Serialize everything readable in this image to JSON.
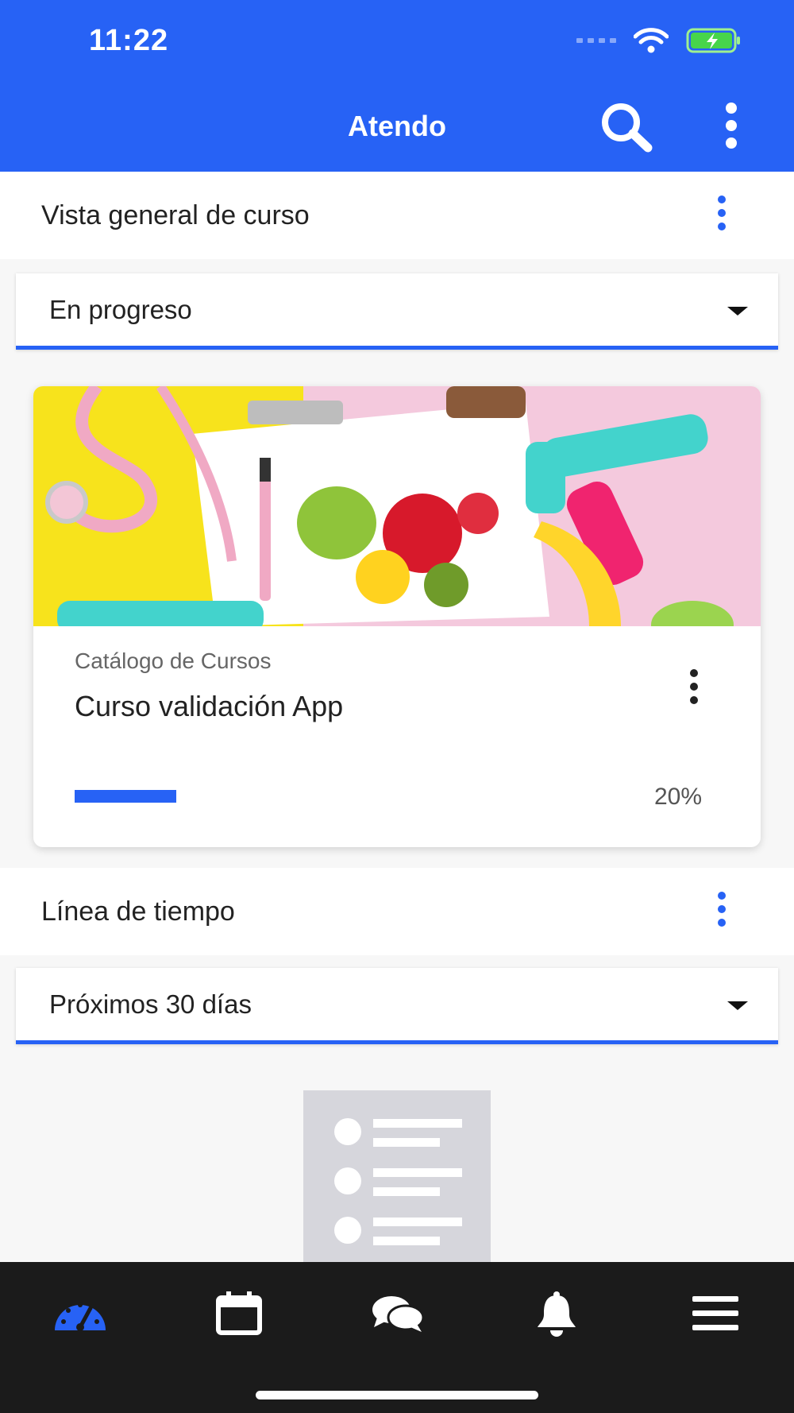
{
  "status_bar": {
    "time": "11:22"
  },
  "app_bar": {
    "title": "Atendo",
    "search_icon": "search-icon",
    "menu_icon": "kebab-menu-icon"
  },
  "course_overview": {
    "title": "Vista general de curso",
    "filter": {
      "selected": "En progreso"
    },
    "course": {
      "category": "Catálogo de Cursos",
      "name": "Curso validación App",
      "progress_value": 0.2,
      "progress_text": "20%"
    }
  },
  "timeline": {
    "title": "Línea de tiempo",
    "filter": {
      "selected": "Próximos 30 días"
    }
  },
  "bottom_nav": {
    "items": [
      {
        "icon": "dashboard-gauge-icon",
        "active": true
      },
      {
        "icon": "calendar-icon",
        "active": false
      },
      {
        "icon": "messages-icon",
        "active": false
      },
      {
        "icon": "notifications-bell-icon",
        "active": false
      },
      {
        "icon": "hamburger-menu-icon",
        "active": false
      }
    ]
  },
  "colors": {
    "primary": "#2762f5",
    "nav_background": "#1b1b1b",
    "page_background": "#f7f7f7"
  }
}
